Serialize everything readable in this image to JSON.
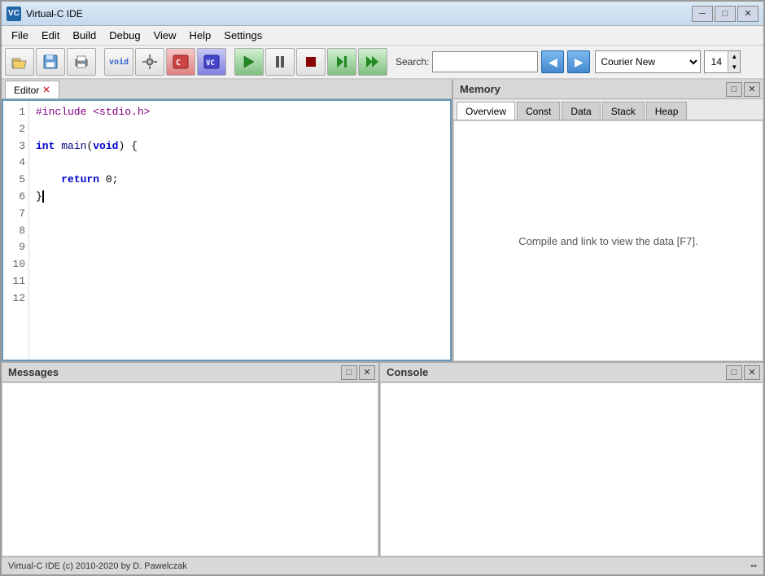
{
  "titlebar": {
    "app_icon": "VC",
    "title": "Virtual-C IDE",
    "minimize_label": "─",
    "maximize_label": "□",
    "close_label": "✕"
  },
  "menubar": {
    "items": [
      {
        "label": "File"
      },
      {
        "label": "Edit"
      },
      {
        "label": "Build"
      },
      {
        "label": "Debug"
      },
      {
        "label": "View"
      },
      {
        "label": "Help"
      },
      {
        "label": "Settings"
      }
    ]
  },
  "toolbar": {
    "buttons": [
      {
        "name": "open-button",
        "icon": "📂"
      },
      {
        "name": "save-button",
        "icon": "💾"
      },
      {
        "name": "print-button",
        "icon": "🖨"
      },
      {
        "name": "void-button",
        "icon": "⬜"
      },
      {
        "name": "compile-button",
        "icon": "⚙"
      },
      {
        "name": "build-button",
        "icon": "🔨"
      },
      {
        "name": "build2-button",
        "icon": "📦"
      },
      {
        "name": "run-button",
        "icon": "▶"
      },
      {
        "name": "pause-button",
        "icon": "⏸"
      },
      {
        "name": "stop-button",
        "icon": "⏹"
      },
      {
        "name": "step-button",
        "icon": "⏭"
      },
      {
        "name": "step2-button",
        "icon": "⏩"
      }
    ],
    "font_name": "Courier New",
    "font_size": "14",
    "search_label": "Search:",
    "search_placeholder": "",
    "nav_prev_icon": "◀",
    "nav_next_icon": "▶"
  },
  "editor": {
    "tab_label": "Editor",
    "tab_close": "✕",
    "line_numbers": [
      "1",
      "2",
      "3",
      "4",
      "5",
      "6",
      "7",
      "8",
      "9",
      "10",
      "11",
      "12"
    ],
    "code_lines": [
      {
        "type": "preprocessor",
        "text": "#include <stdio.h>"
      },
      {
        "type": "blank",
        "text": ""
      },
      {
        "type": "code",
        "text": "int main(void) {"
      },
      {
        "type": "blank",
        "text": ""
      },
      {
        "type": "code",
        "text": "    return 0;"
      },
      {
        "type": "code_cursor",
        "text": "}"
      },
      {
        "type": "blank",
        "text": ""
      },
      {
        "type": "blank",
        "text": ""
      },
      {
        "type": "blank",
        "text": ""
      },
      {
        "type": "blank",
        "text": ""
      },
      {
        "type": "blank",
        "text": ""
      },
      {
        "type": "blank",
        "text": ""
      }
    ]
  },
  "memory": {
    "panel_title": "Memory",
    "tabs": [
      {
        "label": "Overview",
        "active": true
      },
      {
        "label": "Const"
      },
      {
        "label": "Data"
      },
      {
        "label": "Stack"
      },
      {
        "label": "Heap"
      }
    ],
    "empty_text": "Compile and link to view the data [F7].",
    "expand_icon": "□",
    "close_icon": "✕"
  },
  "messages": {
    "panel_title": "Messages",
    "expand_icon": "□",
    "close_icon": "✕"
  },
  "console": {
    "panel_title": "Console",
    "expand_icon": "□",
    "close_icon": "✕"
  },
  "statusbar": {
    "text": "Virtual-C IDE (c) 2010-2020 by D. Pawelczak",
    "right_text": ""
  }
}
